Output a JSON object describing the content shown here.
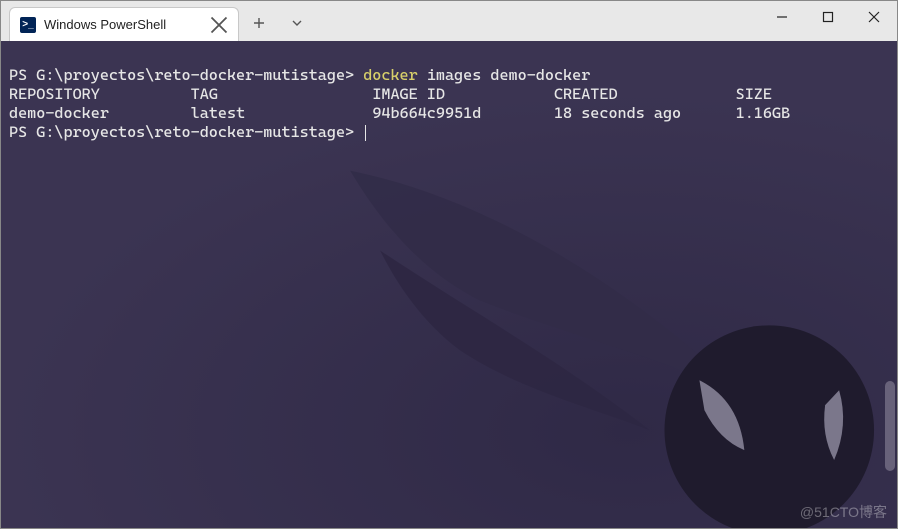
{
  "tab": {
    "title": "Windows PowerShell",
    "icon_glyph": ">_"
  },
  "terminal": {
    "prompt1": "PS G:\\proyectos\\reto-docker-mutistage>",
    "command1": "docker",
    "command1_args": "images demo-docker",
    "header_row": {
      "repository": "REPOSITORY",
      "tag": "TAG",
      "image_id": "IMAGE ID",
      "created": "CREATED",
      "size": "SIZE"
    },
    "row": {
      "repository": "demo-docker",
      "tag": "latest",
      "image_id": "94b664c9951d",
      "created": "18 seconds ago",
      "size": "1.16GB"
    },
    "prompt2": "PS G:\\proyectos\\reto-docker-mutistage>"
  },
  "watermark": "@51CTO博客"
}
